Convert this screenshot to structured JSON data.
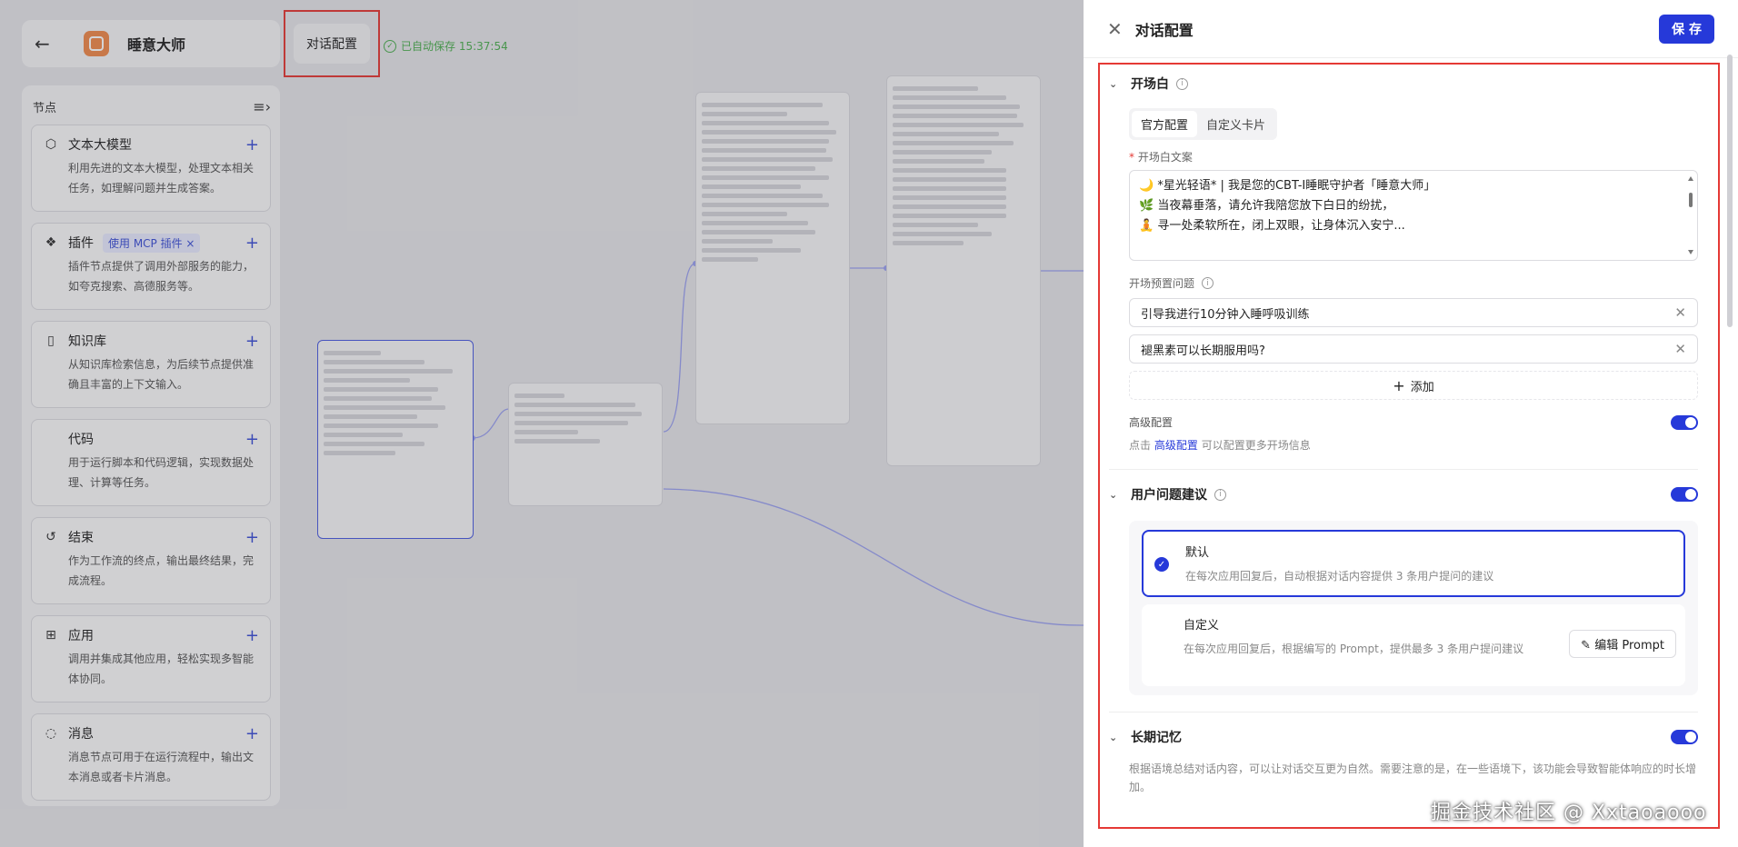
{
  "header": {
    "app_name": "睡意大师",
    "active_tab": "对话配置",
    "autosave": "已自动保存 15:37:54"
  },
  "nodes_panel": {
    "title": "节点",
    "items": [
      {
        "icon": "cube-icon",
        "label": "文本大模型",
        "tag": "",
        "desc": "利用先进的文本大模型，处理文本相关任务，如理解问题并生成答案。"
      },
      {
        "icon": "puzzle-icon",
        "label": "插件",
        "tag": "使用 MCP 插件 ×",
        "desc": "插件节点提供了调用外部服务的能力，如夸克搜索、高德服务等。"
      },
      {
        "icon": "book-icon",
        "label": "知识库",
        "tag": "",
        "desc": "从知识库检索信息，为后续节点提供准确且丰富的上下文输入。"
      },
      {
        "icon": "code-icon",
        "label": "代码",
        "tag": "",
        "desc": "用于运行脚本和代码逻辑，实现数据处理、计算等任务。"
      },
      {
        "icon": "end-icon",
        "label": "结束",
        "tag": "",
        "desc": "作为工作流的终点，输出最终结果，完成流程。"
      },
      {
        "icon": "grid-icon",
        "label": "应用",
        "tag": "",
        "desc": "调用并集成其他应用，轻松实现多智能体协同。"
      },
      {
        "icon": "chat-icon",
        "label": "消息",
        "tag": "",
        "desc": "消息节点可用于在运行流程中，输出文本消息或者卡片消息。"
      }
    ]
  },
  "config": {
    "title": "对话配置",
    "save": "保 存",
    "opening": {
      "title": "开场白",
      "tabs": [
        "官方配置",
        "自定义卡片"
      ],
      "text_label": "开场白文案",
      "lines": [
        "🌙 *星光轻语* | 我是您的CBT-I睡眠守护者「睡意大师」",
        "🌿 当夜幕垂落，请允许我陪您放下白日的纷扰，",
        "🧘 寻一处柔软所在，闭上双眼，让身体沉入安宁..."
      ],
      "preset_label": "开场预置问题",
      "questions": [
        "引导我进行10分钟入睡呼吸训练",
        "褪黑素可以长期服用吗?"
      ],
      "add": "添加",
      "advanced_label": "高级配置",
      "advanced_hint_pre": "点击",
      "advanced_link": "高级配置",
      "advanced_hint_post": "可以配置更多开场信息"
    },
    "suggest": {
      "title": "用户问题建议",
      "options": [
        {
          "title": "默认",
          "desc": "在每次应用回复后，自动根据对话内容提供 3 条用户提问的建议"
        },
        {
          "title": "自定义",
          "desc": "在每次应用回复后，根据编写的 Prompt，提供最多 3 条用户提问建议"
        }
      ],
      "edit": "编辑 Prompt"
    },
    "memory": {
      "title": "长期记忆",
      "desc": "根据语境总结对话内容，可以让对话交互更为自然。需要注意的是，在一些语境下，该功能会导致智能体响应的时长增加。"
    }
  },
  "watermark": "掘金技术社区 @ Xxtaoaooo",
  "colors": {
    "accent": "#2639d9",
    "highlight_box": "#e53935",
    "autosave": "#4caf50"
  }
}
